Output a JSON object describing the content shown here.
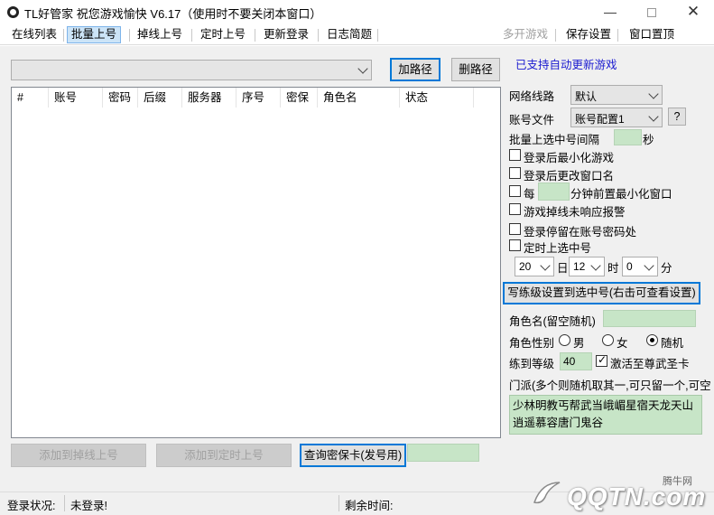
{
  "window": {
    "title": "TL好管家 祝您游戏愉快 V6.17（使用时不要关闭本窗口）",
    "minimize_glyph": "—",
    "close_glyph": "✕"
  },
  "menu": {
    "items": [
      "在线列表",
      "批量上号",
      "掉线上号",
      "定时上号",
      "更新登录",
      "日志简题"
    ],
    "right_items": [
      "多开游戏",
      "保存设置",
      "窗口置顶"
    ]
  },
  "path": {
    "combo_value": "",
    "add_label": "加路径",
    "delete_label": "删路径",
    "auto_update_note": "已支持自动更新游戏"
  },
  "table": {
    "columns": [
      "#",
      "账号",
      "密码",
      "后缀",
      "服务器",
      "序号",
      "密保",
      "角色名",
      "状态"
    ]
  },
  "settings": {
    "network_label": "网络线路",
    "network_value": "默认",
    "account_file_label": "账号文件",
    "account_file_value": "账号配置1",
    "help_label": "?",
    "interval_label": "批量上选中号间隔",
    "interval_value": "",
    "interval_unit": "秒",
    "minimize_after_login": "登录后最小化游戏",
    "rename_after_login": "登录后更改窗口名",
    "every_label": "每",
    "every_value": "",
    "every_suffix": "分钟前置最小化窗口",
    "disconnect_alert": "游戏掉线未响应报警",
    "stay_at_password": "登录停留在账号密码处",
    "timed_login": "定时上选中号",
    "day_value": "20",
    "day_unit": "日",
    "hour_value": "12",
    "hour_unit": "时",
    "minute_value": "0",
    "minute_unit": "分",
    "write_level_btn": "写练级设置到选中号(右击可查看设置)",
    "role_name_label": "角色名(留空随机)",
    "role_name_value": "",
    "gender_label": "角色性别",
    "gender_male": "男",
    "gender_female": "女",
    "gender_random": "随机",
    "level_label": "练到等级",
    "level_value": "40",
    "activate_card": "激活至尊武圣卡",
    "sect_label": "门派(多个则随机取其一,可只留一个,可空",
    "sect_value": "少林明教丐帮武当峨嵋星宿天龙天山逍遥慕容唐门鬼谷"
  },
  "bottom": {
    "add_disconnect_btn": "添加到掉线上号",
    "add_timed_btn": "添加到定时上号",
    "query_card_btn": "查询密保卡(发号用)",
    "query_value": ""
  },
  "status": {
    "login_status_label": "登录状况:",
    "login_status_value": "未登录!",
    "remaining_label": "剩余时间:",
    "remaining_value": ""
  },
  "watermark": {
    "site_small": "腾牛网",
    "site_big": "QQTN.com"
  }
}
